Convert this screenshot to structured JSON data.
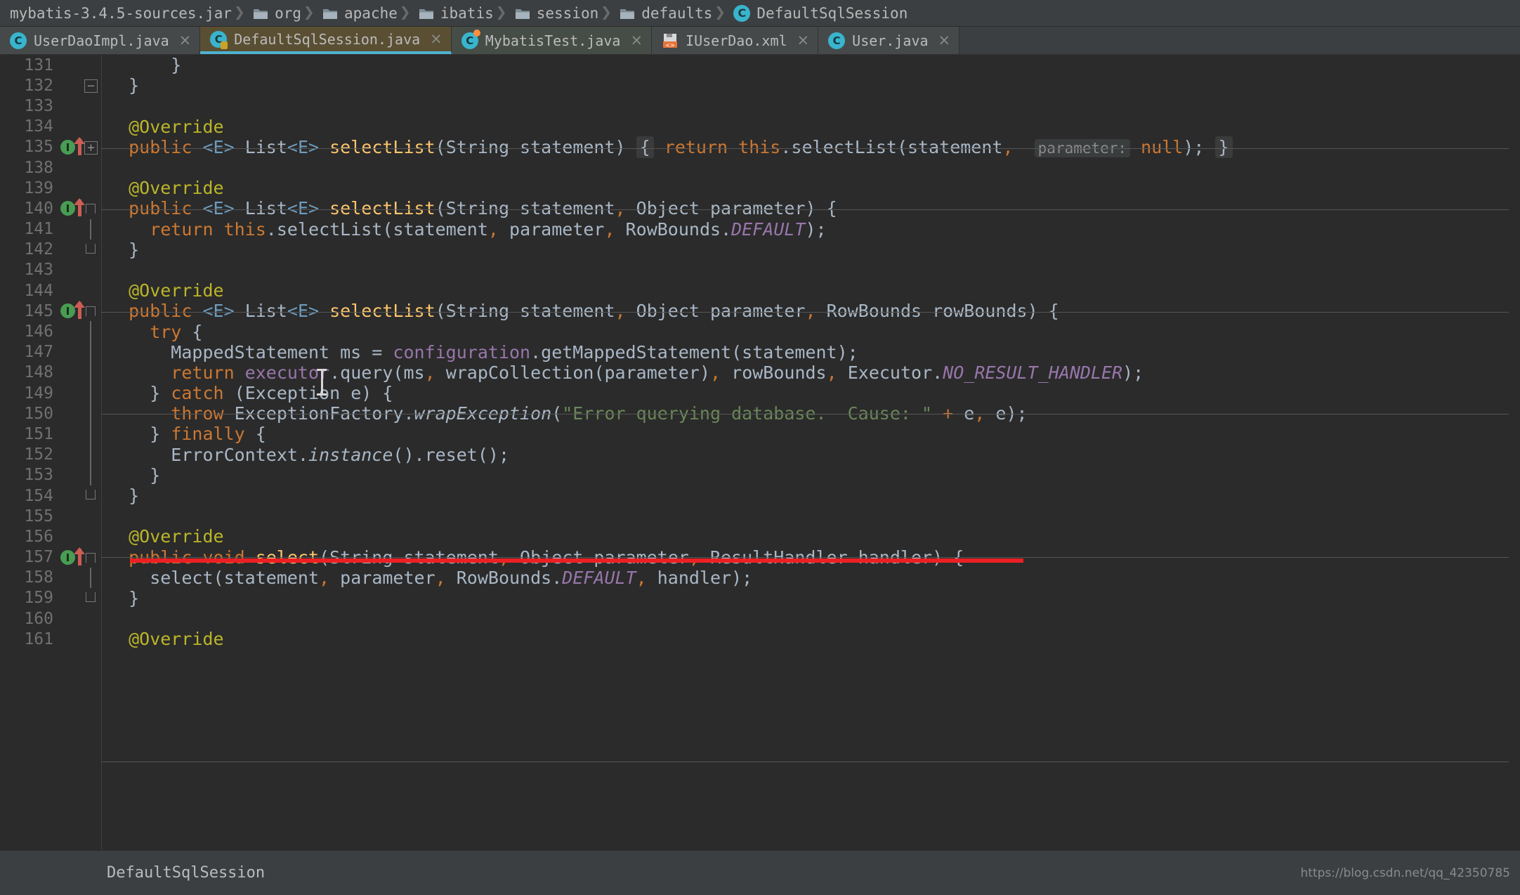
{
  "breadcrumb": {
    "items": [
      {
        "label": "mybatis-3.4.5-sources.jar",
        "icon": "jar-icon"
      },
      {
        "label": "org",
        "icon": "folder-icon"
      },
      {
        "label": "apache",
        "icon": "folder-icon"
      },
      {
        "label": "ibatis",
        "icon": "folder-icon"
      },
      {
        "label": "session",
        "icon": "folder-icon"
      },
      {
        "label": "defaults",
        "icon": "folder-icon"
      },
      {
        "label": "DefaultSqlSession",
        "icon": "java-class-icon"
      }
    ]
  },
  "tabs": [
    {
      "label": "UserDaoImpl.java",
      "icon": "java-class-icon",
      "active": false,
      "close": "×"
    },
    {
      "label": "DefaultSqlSession.java",
      "icon": "java-class-readonly-icon",
      "active": true,
      "close": "×"
    },
    {
      "label": "MybatisTest.java",
      "icon": "java-test-class-icon",
      "active": false,
      "close": "×"
    },
    {
      "label": "IUserDao.xml",
      "icon": "xml-mapper-icon",
      "active": false,
      "close": "×"
    },
    {
      "label": "User.java",
      "icon": "java-class-icon",
      "active": false,
      "close": "×"
    }
  ],
  "editor": {
    "first_line": 131,
    "lines": [
      {
        "n": "131"
      },
      {
        "n": "132"
      },
      {
        "n": "133"
      },
      {
        "n": "134"
      },
      {
        "n": "135"
      },
      {
        "n": "138"
      },
      {
        "n": "139"
      },
      {
        "n": "140"
      },
      {
        "n": "141"
      },
      {
        "n": "142"
      },
      {
        "n": "143"
      },
      {
        "n": "144"
      },
      {
        "n": "145"
      },
      {
        "n": "146"
      },
      {
        "n": "147"
      },
      {
        "n": "148"
      },
      {
        "n": "149"
      },
      {
        "n": "150"
      },
      {
        "n": "151"
      },
      {
        "n": "152"
      },
      {
        "n": "153"
      },
      {
        "n": "154"
      },
      {
        "n": "155"
      },
      {
        "n": "156"
      },
      {
        "n": "157"
      },
      {
        "n": "158"
      },
      {
        "n": "159"
      },
      {
        "n": "160"
      },
      {
        "n": "161"
      }
    ],
    "text": {
      "l131": "}",
      "l132": "}",
      "l133": "",
      "l134": "@Override",
      "l135": "public <E> List<E> selectList(String statement) { return this.selectList(statement, parameter: null); }",
      "l135_hint": "parameter:",
      "l138": "",
      "l139": "@Override",
      "l140": "public <E> List<E> selectList(String statement, Object parameter) {",
      "l141": "return this.selectList(statement, parameter, RowBounds.DEFAULT);",
      "l142": "}",
      "l143": "",
      "l144": "@Override",
      "l145": "public <E> List<E> selectList(String statement, Object parameter, RowBounds rowBounds) {",
      "l146": "try {",
      "l147": "MappedStatement ms = configuration.getMappedStatement(statement);",
      "l148": "return executor.query(ms, wrapCollection(parameter), rowBounds, Executor.NO_RESULT_HANDLER);",
      "l149": "} catch (Exception e) {",
      "l150": "throw ExceptionFactory.wrapException(\"Error querying database.  Cause: \" + e, e);",
      "l151": "} finally {",
      "l152": "ErrorContext.instance().reset();",
      "l153": "}",
      "l154": "}",
      "l155": "",
      "l156": "@Override",
      "l157": "public void select(String statement, Object parameter, ResultHandler handler) {",
      "l158": "select(statement, parameter, RowBounds.DEFAULT, handler);",
      "l159": "}",
      "l160": "",
      "l161": "@Override"
    },
    "annotation": {
      "type": "red-underline",
      "target_line": "148"
    }
  },
  "statusbar": {
    "label": "DefaultSqlSession",
    "watermark": "https://blog.csdn.net/qq_42350785"
  },
  "colors": {
    "background": "#2b2b2b",
    "chrome": "#3c3f41",
    "accent": "#4fb3d0",
    "active_tab": "#5a4f33",
    "annotation_red": "#ec2024",
    "keyword": "#cc7832",
    "method": "#ffc66d",
    "string": "#6a8759",
    "field": "#9876aa",
    "annotation_text": "#bbb529",
    "default_text": "#a9b7c6"
  }
}
